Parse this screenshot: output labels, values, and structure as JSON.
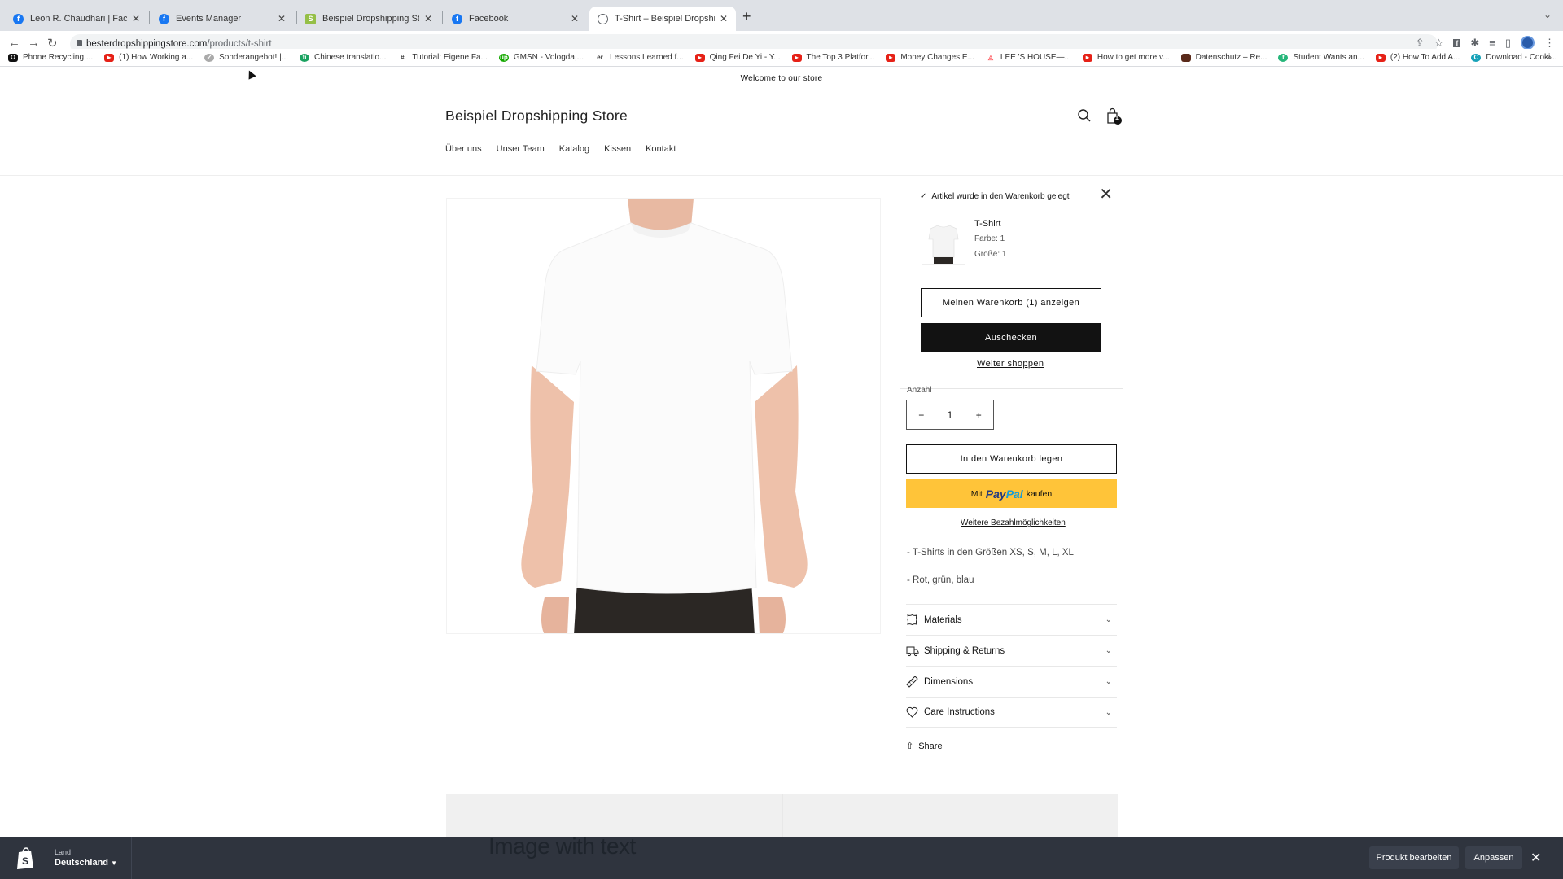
{
  "browser": {
    "tabs": [
      {
        "title": "Leon R. Chaudhari | Facebook",
        "icon": "facebook-icon",
        "color": "#1877f2",
        "active": false
      },
      {
        "title": "Events Manager",
        "icon": "facebook-icon",
        "color": "#1877f2",
        "active": false
      },
      {
        "title": "Beispiel Dropshipping Store · I",
        "icon": "shopify-icon",
        "color": "#95bf47",
        "active": false
      },
      {
        "title": "Facebook",
        "icon": "facebook-icon",
        "color": "#1877f2",
        "active": false
      },
      {
        "title": "T-Shirt – Beispiel Dropshipping",
        "icon": "globe-icon",
        "color": "#5f6368",
        "active": true
      }
    ],
    "url_host": "besterdropshippingstore.com",
    "url_path": "/products/t-shirt",
    "bookmarks": [
      {
        "label": "Phone Recycling,...",
        "color": "#111"
      },
      {
        "label": "(1) How Working a...",
        "color": "#e62117"
      },
      {
        "label": "Sonderangebot! |...",
        "color": "#777"
      },
      {
        "label": "Chinese translatio...",
        "color": "#1aa260"
      },
      {
        "label": "Tutorial: Eigene Fa...",
        "color": "#333"
      },
      {
        "label": "GMSN - Vologda,...",
        "color": "#14a800"
      },
      {
        "label": "Lessons Learned f...",
        "color": "#333"
      },
      {
        "label": "Qing Fei De Yi - Y...",
        "color": "#e62117"
      },
      {
        "label": "The Top 3 Platfor...",
        "color": "#e62117"
      },
      {
        "label": "Money Changes E...",
        "color": "#e62117"
      },
      {
        "label": "LEE 'S HOUSE—...",
        "color": "#ff5a5f"
      },
      {
        "label": "How to get more v...",
        "color": "#e62117"
      },
      {
        "label": "Datenschutz – Re...",
        "color": "#5a2a1a"
      },
      {
        "label": "Student Wants an...",
        "color": "#26b67a"
      },
      {
        "label": "(2) How To Add A...",
        "color": "#e62117"
      },
      {
        "label": "Download - Cooki...",
        "color": "#17a2b8"
      }
    ],
    "bookmarks_more": "»"
  },
  "store": {
    "announcement": "Welcome to our store",
    "name": "Beispiel Dropshipping Store",
    "nav": [
      "Über uns",
      "Unser Team",
      "Katalog",
      "Kissen",
      "Kontakt"
    ],
    "cart_count": "1"
  },
  "popup": {
    "confirmation": "Artikel wurde in den Warenkorb gelegt",
    "product_name": "T-Shirt",
    "options": [
      "Farbe: 1",
      "Größe: 1"
    ],
    "view_cart": "Meinen Warenkorb (1) anzeigen",
    "checkout": "Auschecken",
    "continue": "Weiter shoppen"
  },
  "product": {
    "quantity_label": "Anzahl",
    "quantity": "1",
    "add_to_cart": "In den Warenkorb legen",
    "paypal_prefix": "Mit",
    "paypal_brand_1": "Pay",
    "paypal_brand_2": "Pal",
    "paypal_suffix": "kaufen",
    "more_payment": "Weitere Bezahlmöglichkeiten",
    "description": [
      "- T-Shirts in den Größen XS, S, M, L, XL",
      "- Rot, grün, blau"
    ],
    "accordion": [
      {
        "label": "Materials",
        "icon": "leather-icon"
      },
      {
        "label": "Shipping & Returns",
        "icon": "truck-icon"
      },
      {
        "label": "Dimensions",
        "icon": "ruler-icon"
      },
      {
        "label": "Care Instructions",
        "icon": "heart-icon"
      }
    ],
    "share": "Share"
  },
  "section": {
    "image_with_text_title": "Image with text"
  },
  "preview_bar": {
    "land_label": "Land",
    "country": "Deutschland",
    "edit_product": "Produkt bearbeiten",
    "customize": "Anpassen"
  }
}
